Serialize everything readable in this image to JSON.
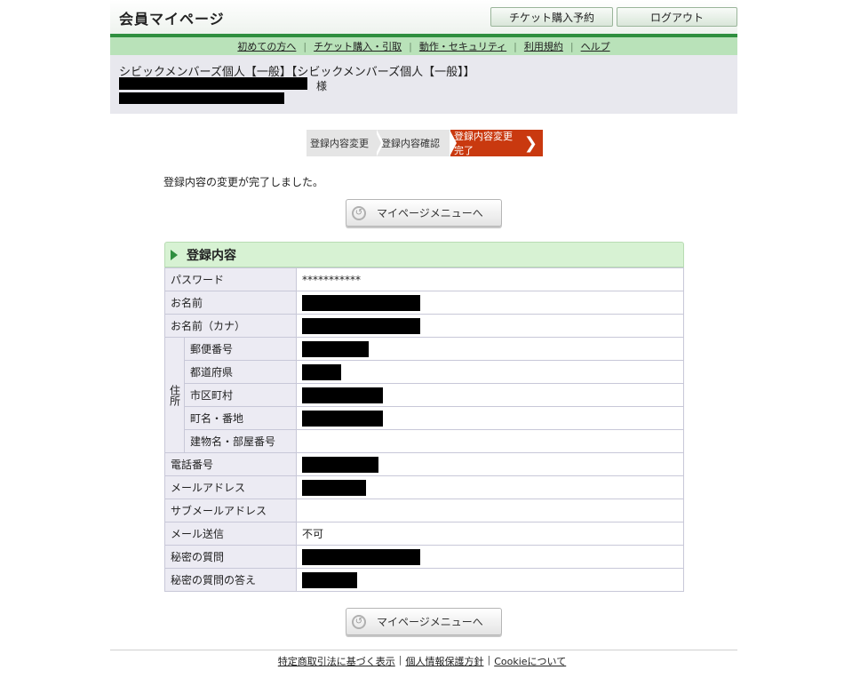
{
  "header": {
    "title": "会員マイページ",
    "ticket_button": "チケット購入予約",
    "logout_button": "ログアウト"
  },
  "nav": {
    "items": [
      "初めての方へ",
      "チケット購入・引取",
      "動作・セキュリティ",
      "利用規約",
      "ヘルプ"
    ]
  },
  "member": {
    "membership": "シビックメンバーズ個人【一般】【シビックメンバーズ個人【一般】】",
    "honorific": "様"
  },
  "steps": {
    "step1": "登録内容変更",
    "step2": "登録内容確認",
    "step3": "登録内容変更完了"
  },
  "message": "登録内容の変更が完了しました。",
  "mypage_menu_button": "マイページメニューへ",
  "section": {
    "title": "登録内容",
    "rows": {
      "password": {
        "label": "パスワード",
        "value": "***********"
      },
      "name": {
        "label": "お名前"
      },
      "name_kana": {
        "label": "お名前（カナ）"
      },
      "address_label": "住所",
      "postal": {
        "label": "郵便番号"
      },
      "prefecture": {
        "label": "都道府県"
      },
      "city": {
        "label": "市区町村"
      },
      "town": {
        "label": "町名・番地"
      },
      "building": {
        "label": "建物名・部屋番号"
      },
      "phone": {
        "label": "電話番号"
      },
      "email": {
        "label": "メールアドレス"
      },
      "sub_email": {
        "label": "サブメールアドレス"
      },
      "mail_send": {
        "label": "メール送信",
        "value": "不可"
      },
      "secret_q": {
        "label": "秘密の質問"
      },
      "secret_a": {
        "label": "秘密の質問の答え"
      }
    }
  },
  "footer": {
    "links": [
      "特定商取引法に基づく表示",
      "個人情報保護方針",
      "Cookieについて"
    ]
  }
}
